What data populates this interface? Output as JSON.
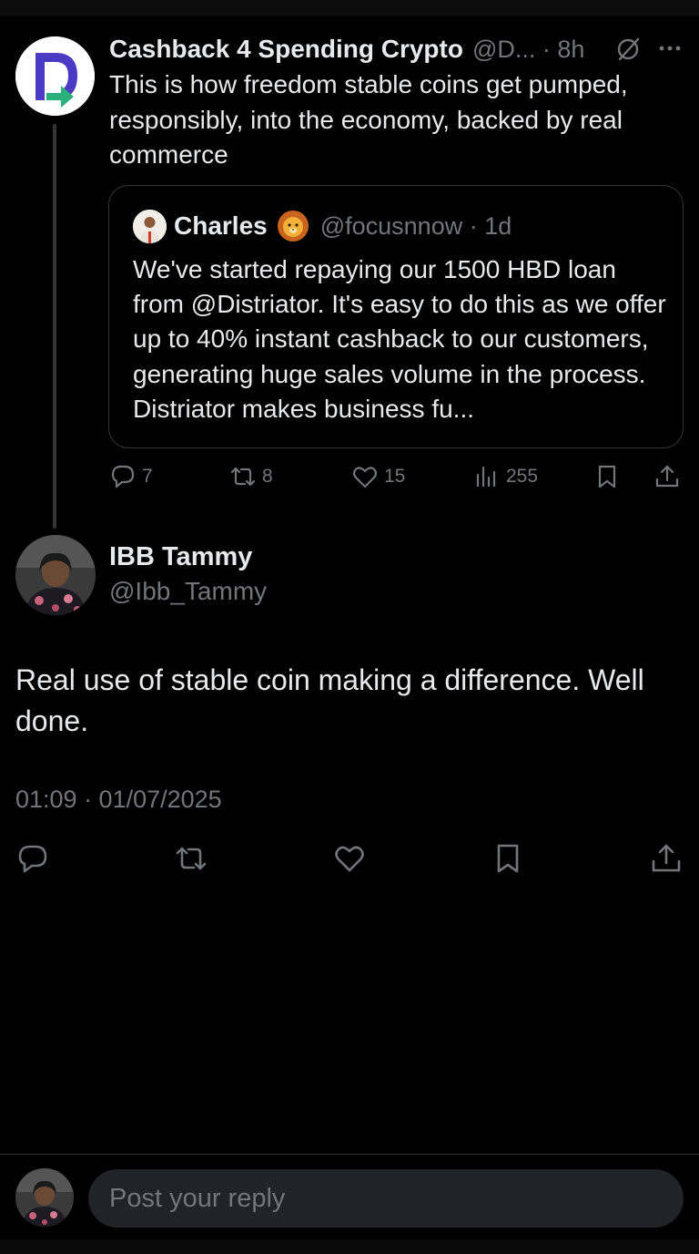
{
  "parent_post": {
    "author_name": "Cashback 4 Spending Crypto",
    "handle_time": "@D... · 8h",
    "text": "This is how freedom stable coins get pumped, responsibly, into the economy, backed by real commerce",
    "quote": {
      "author_name": "Charles",
      "handle_time": "@focusnnow · 1d",
      "text": "We've started repaying our 1500 HBD loan from @Distriator. It's easy to do this as we offer up to 40% instant cashback to our customers, generating huge sales volume in the process. Distriator makes business fu..."
    },
    "stats": {
      "replies": "7",
      "reposts": "8",
      "likes": "15",
      "views": "255"
    }
  },
  "reply_post": {
    "author_name": "IBB Tammy",
    "handle": "@Ibb_Tammy",
    "text": "Real use of stable coin making a difference. Well done.",
    "timestamp": "01:09 · 01/07/2025"
  },
  "composer": {
    "placeholder": "Post your reply"
  },
  "icons": {
    "reply": "comment-icon",
    "repost": "repost-icon",
    "like": "heart-icon",
    "views": "views-chart-icon",
    "bookmark": "bookmark-icon",
    "share": "share-icon",
    "grok": "grok-icon",
    "more": "more-icon"
  },
  "colors": {
    "background": "#000000",
    "text": "#e7e9ea",
    "muted": "#71767b",
    "border": "#333639",
    "input_bg": "#202327"
  }
}
